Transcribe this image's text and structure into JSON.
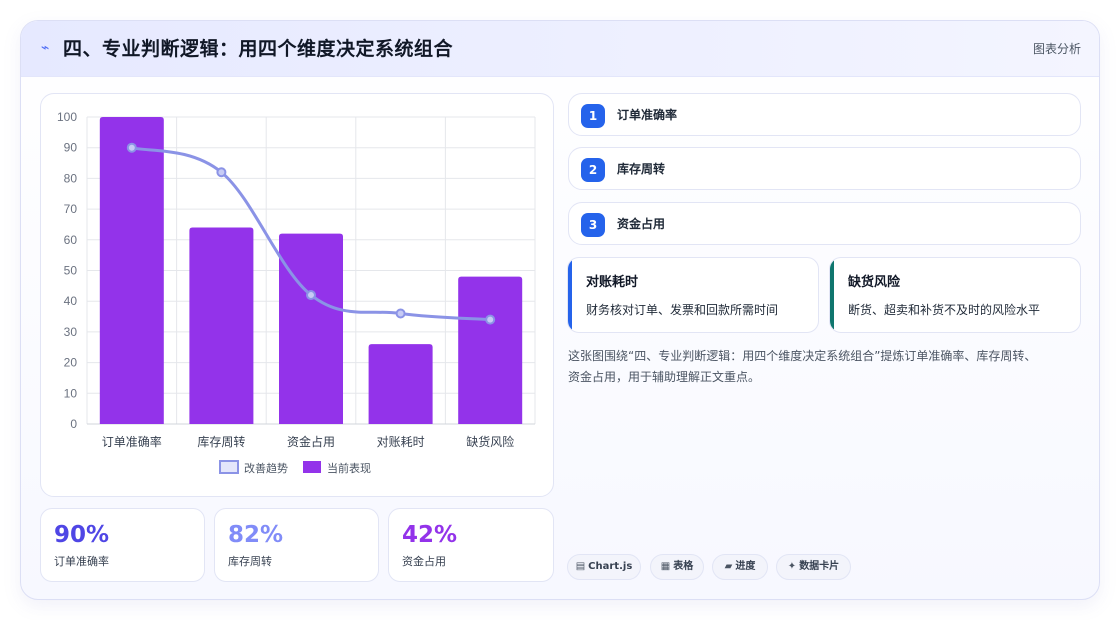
{
  "header": {
    "title": "四、专业判断逻辑：用四个维度决定系统组合",
    "tag": "图表分析"
  },
  "chart_data": {
    "type": "bar",
    "categories": [
      "订单准确率",
      "库存周转",
      "资金占用",
      "对账耗时",
      "缺货风险"
    ],
    "series": [
      {
        "name": "改善趋势",
        "type": "line",
        "values": [
          90,
          82,
          42,
          36,
          34
        ],
        "color": "#8b93e6"
      },
      {
        "name": "当前表现",
        "type": "bar",
        "values": [
          100,
          64,
          62,
          26,
          48
        ],
        "color": "#9333ea"
      }
    ],
    "ylim": [
      0,
      100
    ],
    "yticks": [
      0,
      10,
      20,
      30,
      40,
      50,
      60,
      70,
      80,
      90,
      100
    ],
    "grid": true,
    "legend_position": "bottom"
  },
  "stats": [
    {
      "value": "90%",
      "label": "订单准确率",
      "color": "#4f46e5"
    },
    {
      "value": "82%",
      "label": "库存周转",
      "color": "#818cf8"
    },
    {
      "value": "42%",
      "label": "资金占用",
      "color": "#9333ea"
    }
  ],
  "steps": [
    {
      "num": "1",
      "label": "订单准确率"
    },
    {
      "num": "2",
      "label": "库存周转"
    },
    {
      "num": "3",
      "label": "资金占用"
    }
  ],
  "info_cards": [
    {
      "title": "对账耗时",
      "desc": "财务核对订单、发票和回款所需时间",
      "color": "#2563eb"
    },
    {
      "title": "缺货风险",
      "desc": "断货、超卖和补货不及时的风险水平",
      "color": "#0f766e"
    }
  ],
  "summary_line1": "这张图围绕“四、专业判断逻辑：用四个维度决定系统组合”提炼订单准确率、库存周转、",
  "summary_line2": "资金占用，用于辅助理解正文重点。",
  "pills": [
    {
      "icon": "▤",
      "label": "Chart.js"
    },
    {
      "icon": "▦",
      "label": "表格"
    },
    {
      "icon": "▰",
      "label": "进度"
    },
    {
      "icon": "✦",
      "label": "数据卡片"
    }
  ],
  "colors": {
    "accent": "#2563eb",
    "bar": "#9333ea",
    "line": "#8b93e6"
  }
}
